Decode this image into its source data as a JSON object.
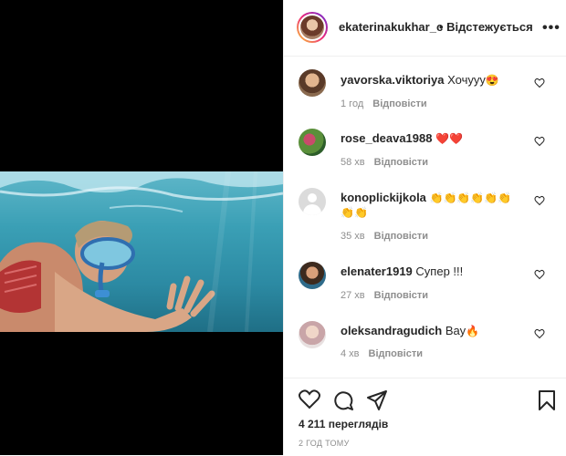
{
  "post": {
    "username": "ekaterinakukhar_c",
    "follow_label": "• Відстежується",
    "more_label": "•••"
  },
  "comments": [
    {
      "user": "yavorska.viktoriya",
      "text": "Хочууу",
      "emoji": "😍",
      "time": "1 год",
      "reply": "Відповісти"
    },
    {
      "user": "rose_deava1988",
      "text": "",
      "emoji": "❤️❤️",
      "time": "58 хв",
      "reply": "Відповісти"
    },
    {
      "user": "konoplickijkola",
      "text": "",
      "emoji": "👏👏👏👏👏👏",
      "emoji2": "👏👏",
      "time": "35 хв",
      "reply": "Відповісти"
    },
    {
      "user": "elenater1919",
      "text": "Супер !!!",
      "emoji": "",
      "time": "27 хв",
      "reply": "Відповісти"
    },
    {
      "user": "oleksandragudich",
      "text": "Вау",
      "emoji": "🔥",
      "time": "4 хв",
      "reply": "Відповісти"
    }
  ],
  "footer": {
    "views": "4 211 переглядів",
    "posted": "2 ГОД ТОМУ"
  },
  "icons": [
    "heart-icon",
    "comment-icon",
    "share-icon",
    "bookmark-icon"
  ]
}
